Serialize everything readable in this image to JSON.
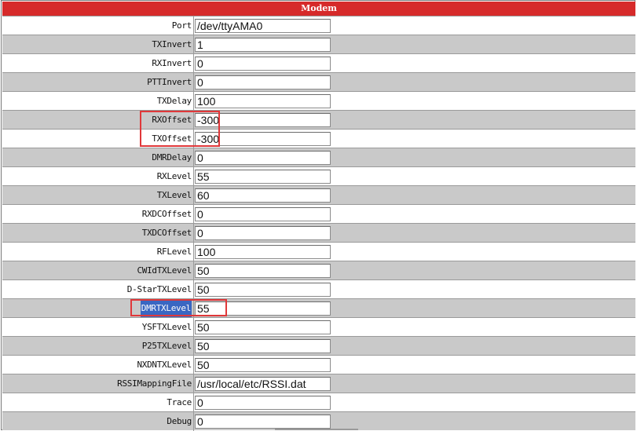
{
  "section": {
    "title": "Modem"
  },
  "rows": [
    {
      "key": "port",
      "label": "Port",
      "value": "/dev/ttyAMA0"
    },
    {
      "key": "txinvert",
      "label": "TXInvert",
      "value": "1"
    },
    {
      "key": "rxinvert",
      "label": "RXInvert",
      "value": "0"
    },
    {
      "key": "pttinvert",
      "label": "PTTInvert",
      "value": "0"
    },
    {
      "key": "txdelay",
      "label": "TXDelay",
      "value": "100"
    },
    {
      "key": "rxoffset",
      "label": "RXOffset",
      "value": "-300",
      "highlighted": true
    },
    {
      "key": "txoffset",
      "label": "TXOffset",
      "value": "-300",
      "highlighted": true
    },
    {
      "key": "dmrdelay",
      "label": "DMRDelay",
      "value": "0"
    },
    {
      "key": "rxlevel",
      "label": "RXLevel",
      "value": "55"
    },
    {
      "key": "txlevel",
      "label": "TXLevel",
      "value": "60"
    },
    {
      "key": "rxdcoffset",
      "label": "RXDCOffset",
      "value": "0"
    },
    {
      "key": "txdcoffset",
      "label": "TXDCOffset",
      "value": "0"
    },
    {
      "key": "rflevel",
      "label": "RFLevel",
      "value": "100"
    },
    {
      "key": "cwidtxlevel",
      "label": "CWIdTXLevel",
      "value": "50"
    },
    {
      "key": "dstartxlevel",
      "label": "D-StarTXLevel",
      "value": "50"
    },
    {
      "key": "dmrtxlevel",
      "label": "DMRTXLevel",
      "value": "55",
      "highlighted": true,
      "label_selected": true
    },
    {
      "key": "ysftxlevel",
      "label": "YSFTXLevel",
      "value": "50"
    },
    {
      "key": "p25txlevel",
      "label": "P25TXLevel",
      "value": "50"
    },
    {
      "key": "nxdntxlevel",
      "label": "NXDNTXLevel",
      "value": "50"
    },
    {
      "key": "rssimappingfile",
      "label": "RSSIMappingFile",
      "value": "/usr/local/etc/RSSI.dat"
    },
    {
      "key": "trace",
      "label": "Trace",
      "value": "0"
    },
    {
      "key": "debug",
      "label": "Debug",
      "value": "0"
    }
  ],
  "colors": {
    "header_bg": "#d62a2a",
    "row_alt_bg": "#c9c9c9",
    "highlight": "#e0383a",
    "selection": "#3a67c2"
  }
}
